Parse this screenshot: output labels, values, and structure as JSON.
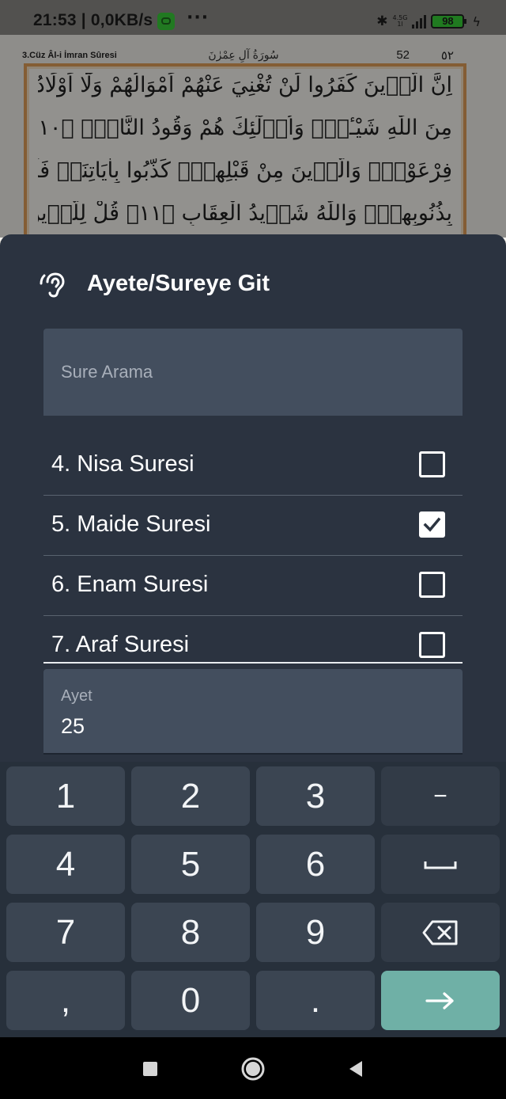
{
  "status_bar": {
    "time_speed": "21:53 | 0,0KB/s",
    "more": "···",
    "network_top": "4.5G",
    "network_bottom": "1l",
    "battery": "98"
  },
  "quran_page": {
    "juz_label": "3.Cüz Âl-i İmran Sûresi",
    "surah_title": "سُورَةُ آلِ عِمْرٰنَ",
    "page_number": "52",
    "page_number_arabic": "٥٢",
    "lines": [
      "اِنَّ الَّذ۪ينَ كَفَرُوا لَنْ تُغْنِيَ عَنْهُمْ اَمْوَالُهُمْ وَلَٓا اَوْلَادُهُمْ",
      "مِنَ اللّٰهِ شَيْـٔاًۜ وَاُو۬لٰٓئِكَ هُمْ وَقُودُ النَّارِۙ ﴿١٠﴾ كَدَاْبِ اٰلِ",
      "فِرْعَوْنَۙ وَالَّذ۪ينَ مِنْ قَبْلِهِمْۜ كَذَّبُوا بِاٰيَاتِنَاۚ فَاَخَذَهُمُ اللّٰهُ",
      "بِذُنُوبِهِمْۜ وَاللّٰهُ شَد۪يدُ الْعِقَابِ ﴿١١﴾ قُلْ لِلَّذ۪ينَ كَفَرُوا"
    ]
  },
  "dialog": {
    "title": "Ayete/Sureye Git",
    "icon": "ear-icon",
    "search_placeholder": "Sure Arama",
    "surahs": [
      {
        "label": "4. Nisa Suresi",
        "checked": false
      },
      {
        "label": "5. Maide Suresi",
        "checked": true
      },
      {
        "label": "6. Enam Suresi",
        "checked": false
      },
      {
        "label": "7. Araf Suresi",
        "checked": false
      }
    ],
    "ayet_label": "Ayet",
    "ayet_value": "25"
  },
  "keypad": {
    "keys": [
      "1",
      "2",
      "3",
      "−",
      "4",
      "5",
      "6",
      "space-icon",
      "7",
      "8",
      "9",
      "backspace-icon",
      ",",
      "0",
      ".",
      "enter-arrow-icon"
    ]
  },
  "colors": {
    "sheet_bg": "#2b3340",
    "field_bg": "#434e5e",
    "enter_key": "#6fb0a6"
  }
}
